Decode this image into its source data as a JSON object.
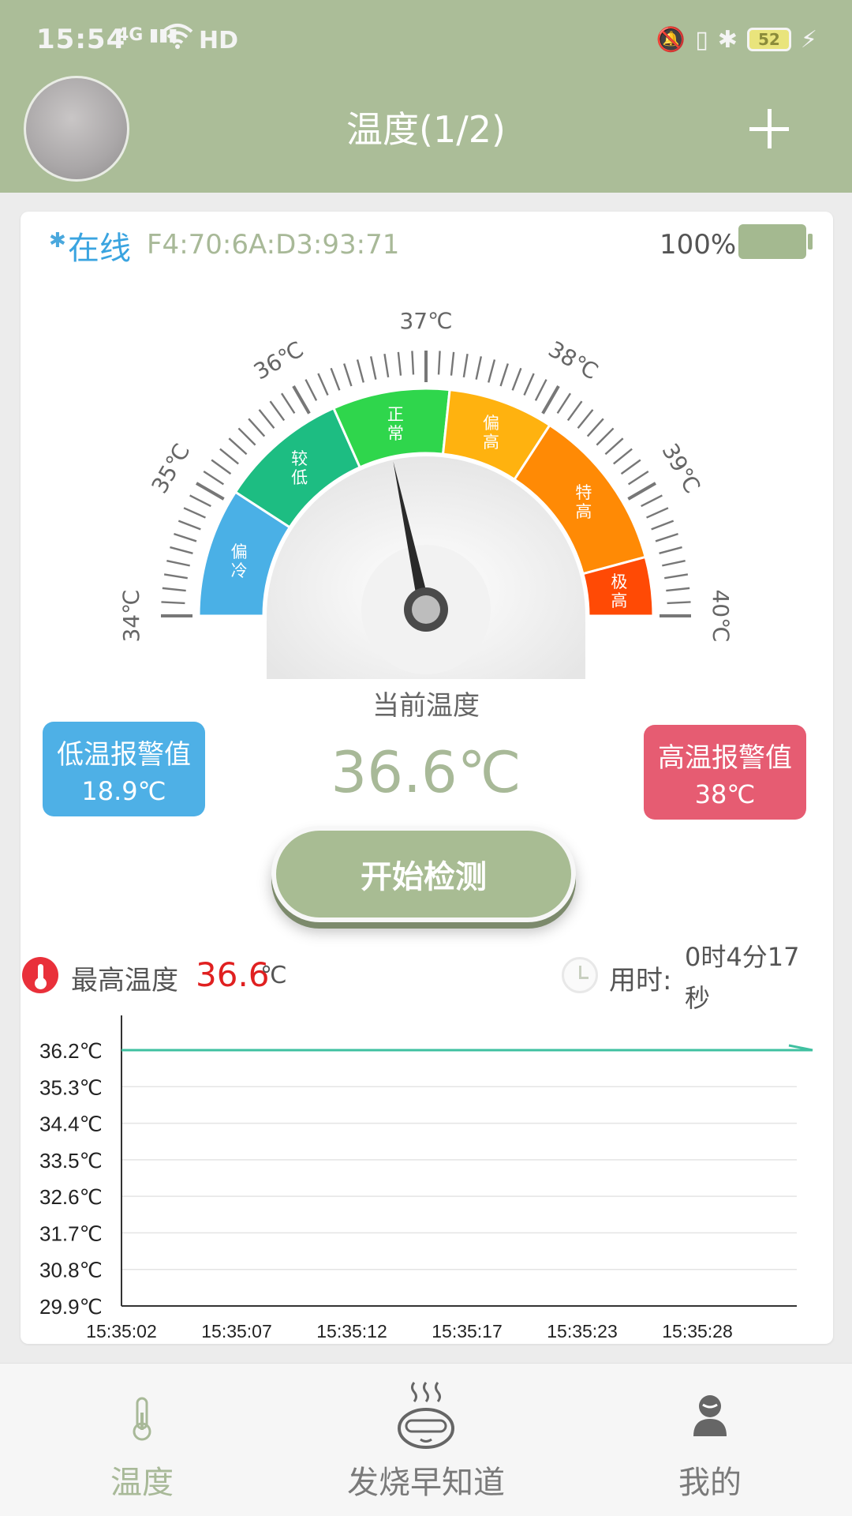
{
  "status_bar": {
    "time": "15:54",
    "network": "4G",
    "wifi_label": "HD",
    "battery_level": "52"
  },
  "header": {
    "title": "温度(1/2)",
    "avatar_icon": "avatar",
    "add_icon": "plus-icon"
  },
  "device": {
    "status": "在线",
    "mac": "F4:70:6A:D3:93:71",
    "battery_pct": "100%"
  },
  "gauge": {
    "ticks": [
      "34℃",
      "35℃",
      "36℃",
      "37℃",
      "38℃",
      "39℃",
      "40℃"
    ],
    "zones": [
      {
        "label": "偏冷",
        "color": "#4ab0e6"
      },
      {
        "label": "较低",
        "color": "#1dbd82"
      },
      {
        "label": "正常",
        "color": "#2fd64c"
      },
      {
        "label": "偏高",
        "color": "#ffb20f"
      },
      {
        "label": "特高",
        "color": "#ff8a05"
      },
      {
        "label": "极高",
        "color": "#ff4a05"
      }
    ],
    "value": 36.6,
    "label": "当前温度",
    "display": "36.6℃"
  },
  "alarms": {
    "low_title": "低温报警值",
    "low_value": "18.9℃",
    "high_title": "高温报警值",
    "high_value": "38℃"
  },
  "start_button": "开始检测",
  "stats": {
    "max_label": "最高温度",
    "max_value": "36.6",
    "max_unit": "℃",
    "time_label": "用时:",
    "time_value": "0时4分17秒"
  },
  "chart_data": {
    "type": "line",
    "y_tick_labels": [
      "36.2℃",
      "35.3℃",
      "34.4℃",
      "33.5℃",
      "32.6℃",
      "31.7℃",
      "30.8℃",
      "29.9℃"
    ],
    "x_tick_labels": [
      "15:35:02",
      "15:35:07",
      "15:35:12",
      "15:35:17",
      "15:35:23",
      "15:35:28"
    ],
    "ylim": [
      29.9,
      36.2
    ],
    "series": [
      {
        "color": "#3fc0a0",
        "x": [
          "15:35:02",
          "15:35:07",
          "15:35:12",
          "15:35:17",
          "15:35:23",
          "15:35:28",
          "15:35:33"
        ],
        "values": [
          36.2,
          36.2,
          36.2,
          36.2,
          36.2,
          36.2,
          36.2
        ]
      }
    ],
    "grid": true
  },
  "tabs": [
    {
      "label": "温度",
      "icon": "thermometer-icon",
      "active": true
    },
    {
      "label": "发烧早知道",
      "icon": "baby-face-icon",
      "active": false
    },
    {
      "label": "我的",
      "icon": "person-icon",
      "active": false
    }
  ],
  "colors": {
    "header": "#abbd98",
    "accent_green": "#a8b998",
    "inactive_tab": "#7a7a7a"
  }
}
